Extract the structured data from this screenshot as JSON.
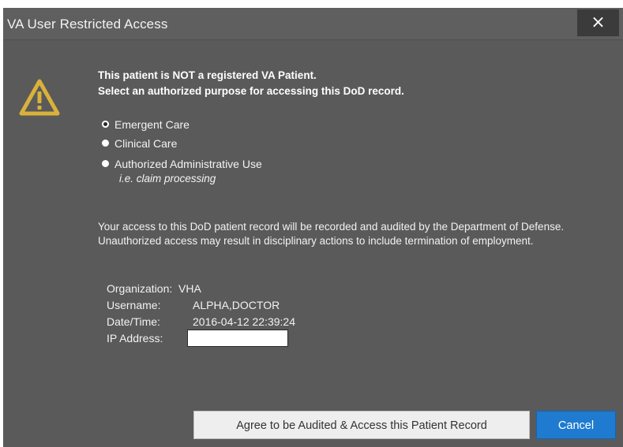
{
  "dialog": {
    "title": "VA User Restricted Access",
    "close_label": "×"
  },
  "warning": {
    "icon": "warning-triangle-icon",
    "icon_color": "#d9b13b",
    "line1": "This patient is NOT a registered VA Patient.",
    "line2": "Select an authorized purpose for accessing this DoD record."
  },
  "purpose_options": [
    {
      "label": "Emergent Care",
      "selected": true
    },
    {
      "label": "Clinical Care",
      "selected": false
    },
    {
      "label": "Authorized Administrative Use",
      "sublabel": "i.e. claim processing",
      "selected": false
    }
  ],
  "notice_text": "Your access to this DoD patient record will be recorded and audited by the Department of Defense. Unauthorized access may result in disciplinary actions to include termination of employment.",
  "info": {
    "organization_label": "Organization:",
    "organization_value": "VHA",
    "username_label": "Username:",
    "username_value": "ALPHA,DOCTOR",
    "datetime_label": "Date/Time:",
    "datetime_value": "2016-04-12 22:39:24",
    "ip_label": "IP Address:",
    "ip_value": ""
  },
  "buttons": {
    "agree_label": "Agree to be Audited & Access this Patient Record",
    "cancel_label": "Cancel"
  },
  "colors": {
    "dialog_bg": "#5a5a5a",
    "accent": "#1f7bd0",
    "warning": "#d9b13b"
  }
}
